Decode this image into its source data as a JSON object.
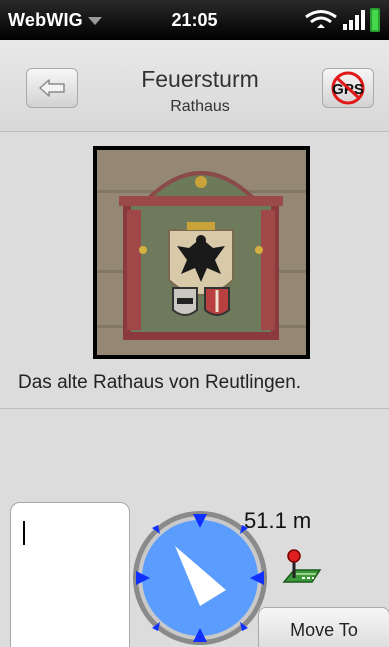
{
  "statusbar": {
    "app_name": "WebWIG",
    "time": "21:05"
  },
  "header": {
    "title": "Feuersturm",
    "subtitle": "Rathaus",
    "gps_label": "GPS",
    "back_icon": "back-arrow-icon",
    "gps_icon": "gps-disabled-icon"
  },
  "content": {
    "description": "Das alte Rathaus von Reutlingen."
  },
  "navigation": {
    "distance": "51.1 m",
    "move_to_label": "Move To",
    "compass_bearing_deg": 320
  },
  "colors": {
    "compass_face": "#5b9dff",
    "compass_ring": "#8a8a8a",
    "compass_ticks": "#1030ff",
    "statusbar": "#000000",
    "battery": "#3cc640"
  }
}
